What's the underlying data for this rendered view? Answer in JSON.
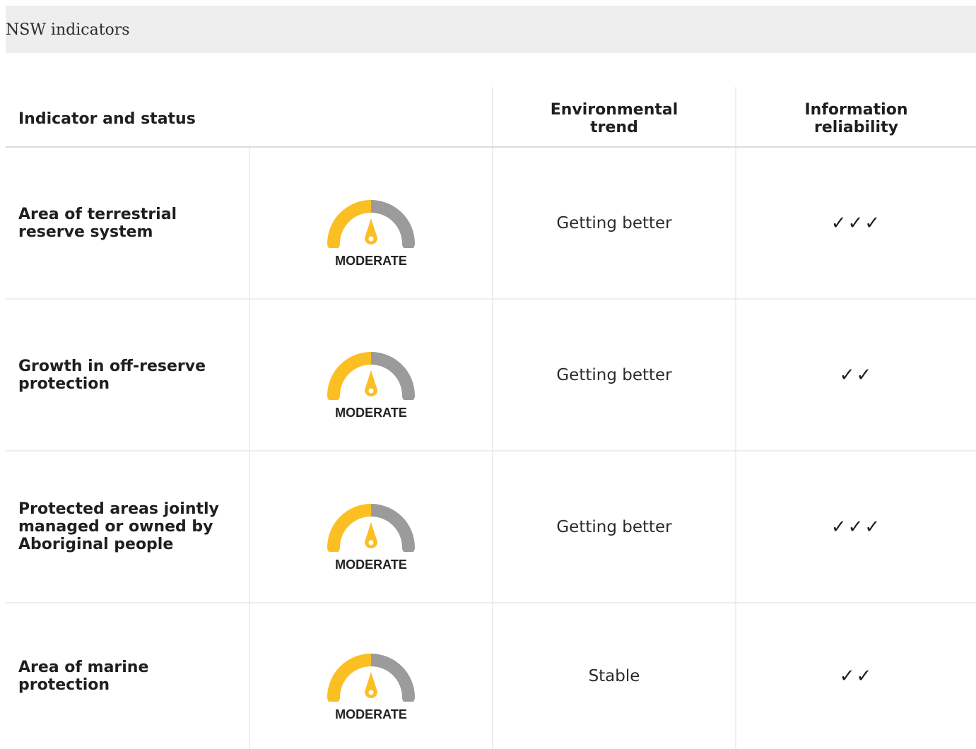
{
  "header": {
    "title": "NSW indicators"
  },
  "table": {
    "columns": {
      "indicator": "Indicator and status",
      "trend_line1": "Environmental",
      "trend_line2": "trend",
      "reliability_line1": "Information",
      "reliability_line2": "reliability"
    },
    "rows": [
      {
        "indicator": "Area of terrestrial reserve system",
        "status": "MODERATE",
        "trend": "Getting better",
        "reliability": "✓✓✓"
      },
      {
        "indicator": "Growth in off-reserve protection",
        "status": "MODERATE",
        "trend": "Getting better",
        "reliability": "✓✓"
      },
      {
        "indicator": "Protected areas jointly managed or owned by Aboriginal people",
        "status": "MODERATE",
        "trend": "Getting better",
        "reliability": "✓✓✓"
      },
      {
        "indicator": "Area of marine protection",
        "status": "MODERATE",
        "trend": "Stable",
        "reliability": "✓✓"
      }
    ]
  },
  "gauge": {
    "icon": "status-gauge-icon",
    "filled_color": "#fbbf24",
    "empty_color": "#9b9b9b",
    "level_fraction": 0.5
  }
}
